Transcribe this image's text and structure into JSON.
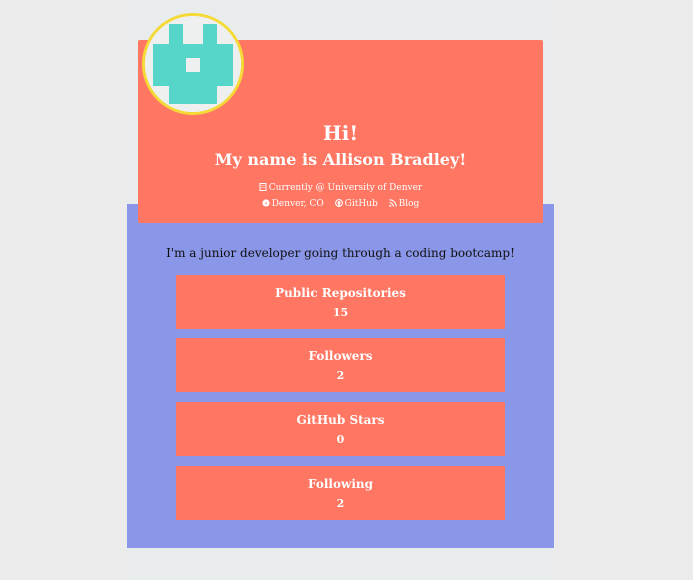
{
  "header": {
    "greeting": "Hi!",
    "name_line": "My name is Allison Bradley!",
    "current_line": "Currently @ University of Denver",
    "location": "Denver, CO",
    "github_link": "GitHub",
    "blog_link": "Blog",
    "icons": {
      "current": "building-icon",
      "location": "location-icon",
      "github": "github-icon",
      "blog": "rss-icon"
    }
  },
  "bio": "I'm a junior developer going through a coding bootcamp!",
  "stats": [
    {
      "label": "Public Repositories",
      "value": "15"
    },
    {
      "label": "Followers",
      "value": "2"
    },
    {
      "label": "GitHub Stars",
      "value": "0"
    },
    {
      "label": "Following",
      "value": "2"
    }
  ],
  "colors": {
    "accent_coral": "#ff7663",
    "section_purple": "#8a96e8",
    "avatar_border": "#f5d936",
    "identicon": "#55d6c8"
  }
}
